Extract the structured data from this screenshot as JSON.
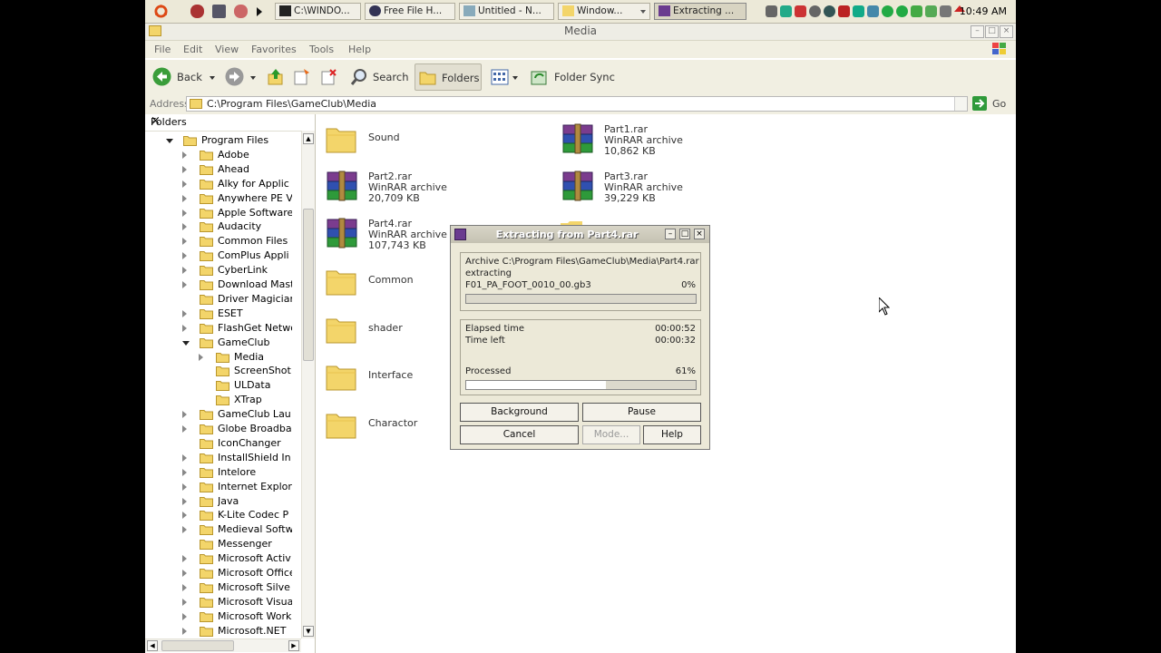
{
  "taskbar": {
    "tasks": [
      "C:\\WINDO...",
      "Free File H...",
      "Untitled - N...",
      "Window...",
      "Extracting ..."
    ],
    "clock": "10:49 AM"
  },
  "window": {
    "title": "Media",
    "menu": [
      "File",
      "Edit",
      "View",
      "Favorites",
      "Tools",
      "Help"
    ],
    "toolbar": {
      "back": "Back",
      "search": "Search",
      "folders": "Folders",
      "folder_sync": "Folder Sync"
    },
    "address": {
      "label": "Address",
      "path": "C:\\Program Files\\GameClub\\Media",
      "go": "Go"
    }
  },
  "folders_pane": {
    "title": "Folders",
    "close": "×",
    "tree": [
      "Program Files",
      "Adobe",
      "Ahead",
      "Alky for Applic",
      "Anywhere PE V",
      "Apple Software",
      "Audacity",
      "Common Files",
      "ComPlus Appli",
      "CyberLink",
      "Download Mast",
      "Driver Magician",
      "ESET",
      "FlashGet Netwo",
      "GameClub",
      "Media",
      "ScreenShot",
      "ULData",
      "XTrap",
      "GameClub Lau",
      "Globe Broadba",
      "IconChanger",
      "InstallShield In",
      "Intelore",
      "Internet Explor",
      "Java",
      "K-Lite Codec P",
      "Medieval Softw",
      "Messenger",
      "Microsoft Activ",
      "Microsoft Office",
      "Microsoft Silve",
      "Microsoft Visua",
      "Microsoft Work",
      "Microsoft.NET"
    ]
  },
  "files": [
    {
      "name": "Sound",
      "type": "",
      "size": ""
    },
    {
      "name": "Part1.rar",
      "type": "WinRAR archive",
      "size": "10,862 KB"
    },
    {
      "name": "Part2.rar",
      "type": "WinRAR archive",
      "size": "20,709 KB"
    },
    {
      "name": "Part3.rar",
      "type": "WinRAR archive",
      "size": "39,229 KB"
    },
    {
      "name": "Part4.rar",
      "type": "WinRAR archive",
      "size": "107,743 KB"
    },
    {
      "name": "Common",
      "type": "",
      "size": ""
    },
    {
      "name": "shader",
      "type": "",
      "size": ""
    },
    {
      "name": "Interface",
      "type": "",
      "size": ""
    },
    {
      "name": "Charactor",
      "type": "",
      "size": ""
    }
  ],
  "dialog": {
    "title": "Extracting from Part4.rar",
    "archive_line": "Archive C:\\Program Files\\GameClub\\Media\\Part4.rar",
    "action": "extracting",
    "current_file": "F01_PA_FOOT_0010_00.gb3",
    "file_percent": "0%",
    "file_progress": 0,
    "elapsed_label": "Elapsed time",
    "elapsed_value": "00:00:52",
    "left_label": "Time left",
    "left_value": "00:00:32",
    "processed_label": "Processed",
    "processed_percent": "61%",
    "processed_progress": 0.61,
    "buttons": {
      "background": "Background",
      "pause": "Pause",
      "cancel": "Cancel",
      "mode": "Mode...",
      "help": "Help"
    }
  },
  "colors": {
    "folder_yellow": "#f3d56a",
    "rar_purple": "#6a3b8f",
    "go_green": "#2f9a3a"
  }
}
